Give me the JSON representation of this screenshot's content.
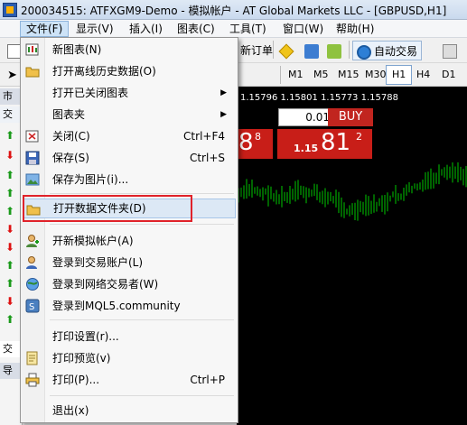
{
  "window": {
    "title": "200034515: ATFXGM9-Demo - 模拟帐户 - AT Global Markets LLC - [GBPUSD,H1]"
  },
  "menubar": [
    "文件(F)",
    "显示(V)",
    "插入(I)",
    "图表(C)",
    "工具(T)",
    "窗口(W)",
    "帮助(H)"
  ],
  "toolbar": {
    "new_order": "新订单",
    "autotrading": "自动交易",
    "timeframes": [
      "M1",
      "M5",
      "M15",
      "M30",
      "H1",
      "H4",
      "D1"
    ],
    "selected_timeframe": "H1"
  },
  "left_panel": {
    "header_fragment": "市",
    "tab_fragment": "交",
    "bottom_fragment_1": "交",
    "bottom_fragment_2": "导"
  },
  "chart": {
    "price_line": "1.15796 1.15801 1.15773 1.15788",
    "lot_value": "0.01",
    "buy_label": "BUY",
    "sell_quote_big": "8",
    "sell_quote_sup": "8",
    "buy_quote_prefix": "1.15",
    "buy_quote_big": "81",
    "buy_quote_sup": "2",
    "candle_color": "#00c800"
  },
  "file_menu": {
    "items": [
      {
        "label": "新图表(N)",
        "shortcut": "",
        "icon": "new-chart-icon"
      },
      {
        "label": "打开离线历史数据(O)",
        "shortcut": "",
        "icon": "open-folder-icon"
      },
      {
        "label": "打开已关闭图表",
        "shortcut": "",
        "submenu": true
      },
      {
        "label": "图表夹",
        "shortcut": "",
        "submenu": true
      },
      {
        "label": "关闭(C)",
        "shortcut": "Ctrl+F4",
        "icon": "close-chart-icon"
      },
      {
        "label": "保存(S)",
        "shortcut": "Ctrl+S",
        "icon": "save-icon"
      },
      {
        "label": "保存为图片(i)...",
        "shortcut": "",
        "icon": "save-picture-icon"
      },
      {
        "label": "打开数据文件夹(D)",
        "shortcut": "",
        "icon": "data-folder-icon",
        "highlighted": true
      },
      {
        "label": "开新模拟帐户(A)",
        "shortcut": "",
        "icon": "demo-account-icon"
      },
      {
        "label": "登录到交易账户(L)",
        "shortcut": "",
        "icon": "login-trade-icon"
      },
      {
        "label": "登录到网络交易者(W)",
        "shortcut": "",
        "icon": "web-trader-icon"
      },
      {
        "label": "登录到MQL5.community",
        "shortcut": "",
        "icon": "mql5-icon"
      },
      {
        "label": "打印设置(r)...",
        "shortcut": "",
        "icon": ""
      },
      {
        "label": "打印预览(v)",
        "shortcut": "",
        "icon": "print-preview-icon"
      },
      {
        "label": "打印(P)...",
        "shortcut": "Ctrl+P",
        "icon": "print-icon"
      },
      {
        "label": "退出(x)",
        "shortcut": "",
        "icon": ""
      }
    ],
    "submenu_arrow": "▶"
  },
  "colors": {
    "highlight_box": "#e0222a",
    "buy_red": "#c81e18"
  }
}
